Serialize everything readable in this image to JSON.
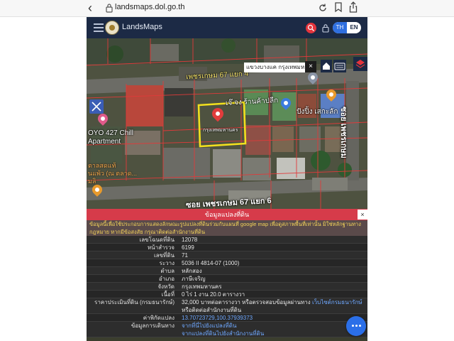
{
  "browser": {
    "back_icon": "chevron-left-icon",
    "url": "landsmaps.dol.go.th",
    "icons": [
      "reload-icon",
      "bookmark-icon",
      "share-icon"
    ]
  },
  "header": {
    "title": "LandsMaps",
    "lang_th": "TH",
    "lang_en": "EN"
  },
  "map": {
    "road_top": "เพชรเกษม 67 แยก 4",
    "road_bottom": "ซอย เพชรเกษม 67 แยก 6",
    "road_right": "ซอย เพชรเกษม",
    "place_oyo": "OYO 427 Chill",
    "place_oyo_2": "Apartment",
    "place_shop": "เจ๊ จง ร้านค้าปลีก",
    "place_food": "ปังปิ้ง เสกะลัก",
    "place_left_1": "ตาลสดแท้",
    "place_left_2": "นแพ้ว (ณ ตลาด...",
    "place_left_3": "มลิ",
    "parcel_label": "กรุงเทพมหานคร",
    "address_box": "แขวงบางแค กรุงเทพมหาน...",
    "close_label": "×"
  },
  "panel": {
    "title": "ข้อมูลแปลงที่ดิน",
    "close_label": "×",
    "notice_text": "ข้อมูลนี้เพื่อใช้ประกอบการแสดงลักษณะรูปแปลงที่ดินร่วมกับแผนที่ google map เพื่อดูสภาพพื้นที่เท่านั้น มิใช่หลักฐานทางกฎหมาย หากมีข้อสงสัย กรุณาติดต่อสำนักงานที่ดิน",
    "rows": [
      {
        "key": "เลขโฉนดที่ดิน",
        "value": "12078"
      },
      {
        "key": "หน้าสำรวจ",
        "value": "6199"
      },
      {
        "key": "เลขที่ดิน",
        "value": "71"
      },
      {
        "key": "ระวาง",
        "value": "5036 II 4814-07 (1000)"
      },
      {
        "key": "ตำบล",
        "value": "หลักสอง"
      },
      {
        "key": "อำเภอ",
        "value": "ภาษีเจริญ"
      },
      {
        "key": "จังหวัด",
        "value": "กรุงเทพมหานคร"
      },
      {
        "key": "เนื้อที่",
        "value": "0 ไร่ 1 งาน 20.0 ตารางวา"
      },
      {
        "key": "ราคาประเมินที่ดิน (กรมธนารักษ์)",
        "value_1": "32,000 บาทต่อตารางวา หรือตรวจสอบข้อมูลผ่านทาง ",
        "value_link": "เว็บไซต์กรมธนารักษ์",
        "value_2": " หรือติดต่อสำนักงานที่ดิน"
      },
      {
        "key": "ค่าพิกัดแปลง",
        "value": "13.70723729,100.37939373"
      },
      {
        "key": "ข้อมูลการเดินทาง",
        "value_1": "จากที่นี่ไปยังแปลงที่ดิน",
        "value_2": "จากแปลงที่ดินไปยังสำนักงานที่ดิน"
      }
    ]
  },
  "colors": {
    "header_bg": "#1c2a45",
    "panel_header": "#d63b4a",
    "lang_active": "#2f6fe0",
    "parcel_outline": "#f2e01e",
    "parcel_lines": "#e03a3a",
    "link": "#6fa8ff"
  },
  "fab_icon": "more-dots-icon"
}
